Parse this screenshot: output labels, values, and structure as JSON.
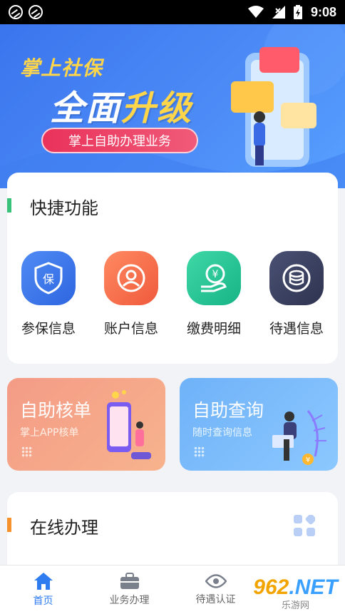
{
  "status_bar": {
    "time": "9:08"
  },
  "banner": {
    "title_line1": "掌上社保",
    "title_line2_a": "全面",
    "title_line2_b": "升级",
    "pill": "掌上自助办理业务"
  },
  "quick": {
    "title": "快捷功能",
    "items": [
      {
        "label": "参保信息",
        "icon": "shield-bao-icon",
        "color": "#3a79ea"
      },
      {
        "label": "账户信息",
        "icon": "account-cycle-icon",
        "color": "#f06a45"
      },
      {
        "label": "缴费明细",
        "icon": "yen-hand-icon",
        "color": "#22c08f"
      },
      {
        "label": "待遇信息",
        "icon": "coin-stack-icon",
        "color": "#3b4160"
      }
    ]
  },
  "cards": {
    "left": {
      "title": "自助核单",
      "subtitle": "掌上APP核单"
    },
    "right": {
      "title": "自助查询",
      "subtitle": "随时查询信息"
    }
  },
  "online": {
    "title": "在线办理"
  },
  "tabbar": {
    "items": [
      {
        "label": "首页",
        "icon": "home-icon",
        "active": true
      },
      {
        "label": "业务办理",
        "icon": "briefcase-icon",
        "active": false
      },
      {
        "label": "待遇认证",
        "icon": "eye-icon",
        "active": false
      }
    ]
  },
  "watermark": {
    "num_a": "962",
    "num_b": ".NET",
    "text": "乐游网"
  }
}
